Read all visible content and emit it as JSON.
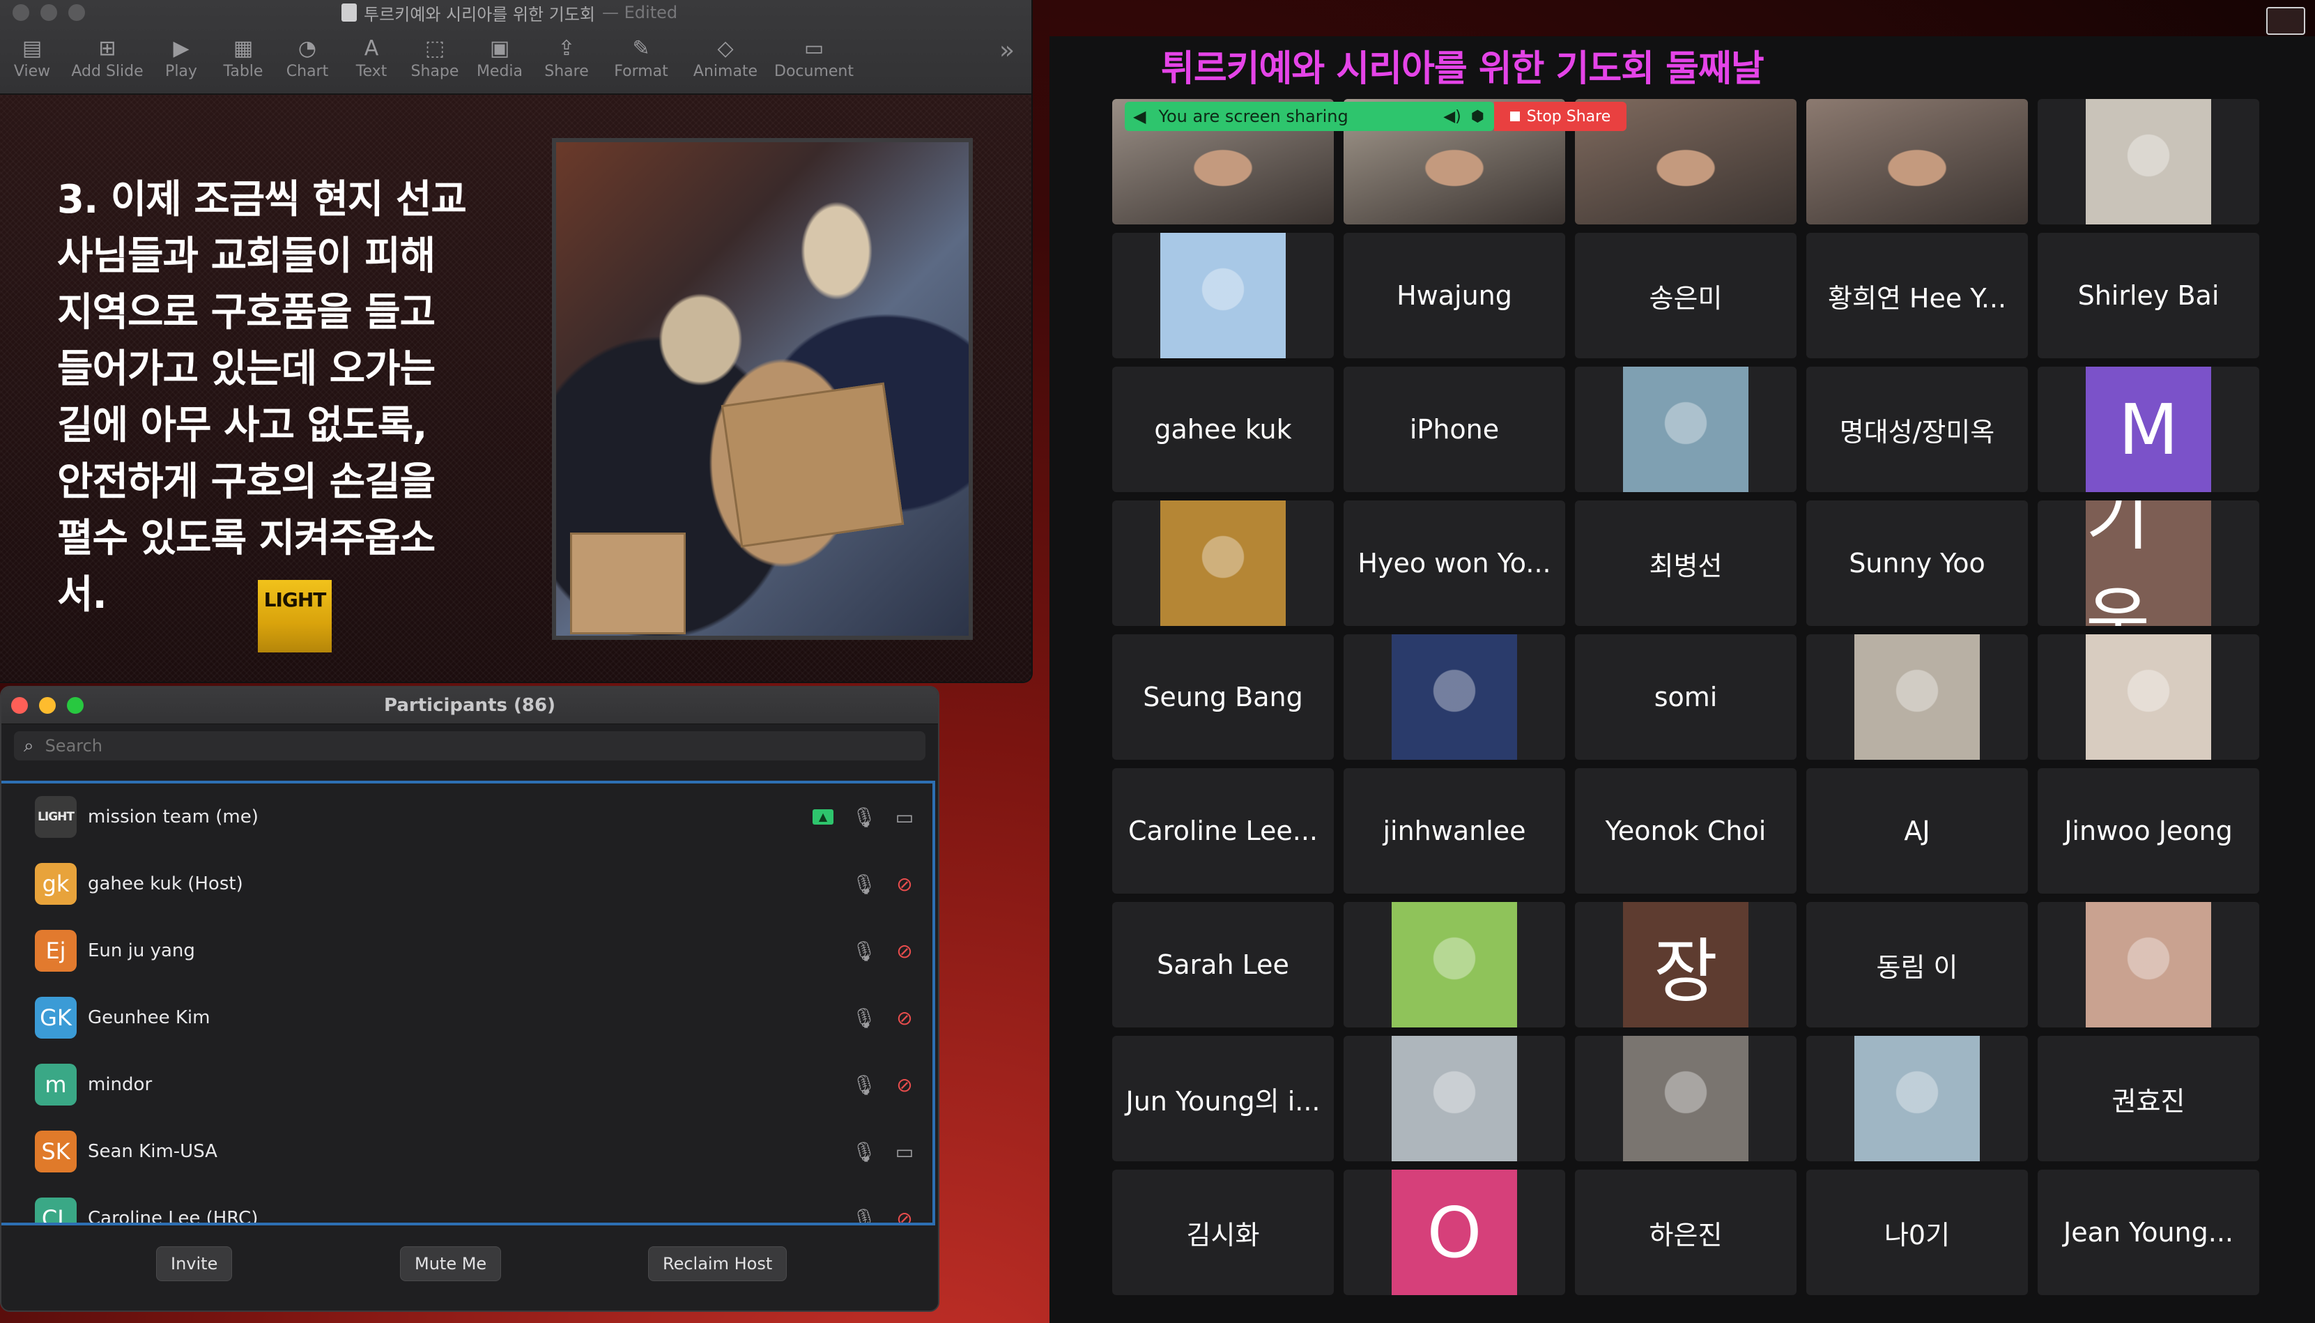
{
  "keynote": {
    "title": "투르키예와 시리아를 위한 기도회",
    "edited": "— Edited",
    "toolbar": [
      "View",
      "Add Slide",
      "Play",
      "Table",
      "Chart",
      "Text",
      "Shape",
      "Media",
      "Share",
      "Format",
      "Animate",
      "Document"
    ],
    "slide_text": "3. 이제 조금씩 현지 선교\n사님들과 교회들이 피해\n지역으로 구호품을 들고\n들어가고 있는데 오가는\n길에 아무 사고 없도록,\n안전하게 구호의 손길을\n펼수 있도록 지켜주옵소\n서.",
    "logo_text": "LIGHT"
  },
  "participants": {
    "title": "Participants (86)",
    "search_placeholder": "Search",
    "rows": [
      {
        "initials": "LIGHT",
        "name": "mission team (me)",
        "color": "#3a3a3a",
        "cam_off": false,
        "sharing": true
      },
      {
        "initials": "gk",
        "name": "gahee kuk (Host)",
        "color": "#e8a33b",
        "cam_off": true,
        "sharing": false
      },
      {
        "initials": "Ej",
        "name": "Eun ju yang",
        "color": "#e27a2e",
        "cam_off": true,
        "sharing": false
      },
      {
        "initials": "GK",
        "name": "Geunhee Kim",
        "color": "#3b9bd6",
        "cam_off": true,
        "sharing": false
      },
      {
        "initials": "m",
        "name": "mindor",
        "color": "#3aa886",
        "cam_off": true,
        "sharing": false
      },
      {
        "initials": "SK",
        "name": "Sean Kim-USA",
        "color": "#e07a2a",
        "cam_off": false,
        "sharing": false
      },
      {
        "initials": "CL",
        "name": "Caroline Lee (HRC)",
        "color": "#3aa886",
        "cam_off": true,
        "sharing": false
      }
    ],
    "buttons": {
      "invite": "Invite",
      "mute": "Mute Me",
      "reclaim": "Reclaim Host"
    }
  },
  "zoom": {
    "title": "튀르키예와 시리아를 위한 기도회 둘째날",
    "share_text": "You are screen sharing",
    "stop_share": "Stop Share",
    "tiles": [
      {
        "type": "video",
        "bg": "#9a8f86"
      },
      {
        "type": "video",
        "bg": "#a49a8e"
      },
      {
        "type": "video",
        "bg": "#7f6a5e"
      },
      {
        "type": "video",
        "bg": "#8c7a70"
      },
      {
        "type": "pic",
        "bg": "#c9c3b9"
      },
      {
        "type": "pic",
        "bg": "#a8c8e6"
      },
      {
        "type": "name",
        "label": "Hwajung"
      },
      {
        "type": "name",
        "label": "송은미"
      },
      {
        "type": "name",
        "label": "황희연  Hee Y..."
      },
      {
        "type": "name",
        "label": "Shirley Bai"
      },
      {
        "type": "name",
        "label": "gahee kuk"
      },
      {
        "type": "name",
        "label": "iPhone"
      },
      {
        "type": "pic",
        "bg": "#7fa0b2"
      },
      {
        "type": "name",
        "label": "명대성/장미옥"
      },
      {
        "type": "letter",
        "label": "M",
        "bg": "#7b52c9"
      },
      {
        "type": "pic",
        "bg": "#b58635"
      },
      {
        "type": "name",
        "label": "Hyeo won Yo..."
      },
      {
        "type": "name",
        "label": "최병선"
      },
      {
        "type": "name",
        "label": "Sunny Yoo"
      },
      {
        "type": "letter",
        "label": "기운",
        "bg": "#7d5e54"
      },
      {
        "type": "name",
        "label": "Seung Bang"
      },
      {
        "type": "pic",
        "bg": "#2a3b6b"
      },
      {
        "type": "name",
        "label": "somi"
      },
      {
        "type": "pic",
        "bg": "#b8b0a4"
      },
      {
        "type": "pic",
        "bg": "#d8ccc0"
      },
      {
        "type": "name",
        "label": "Caroline Lee..."
      },
      {
        "type": "name",
        "label": "jinhwanlee"
      },
      {
        "type": "name",
        "label": "Yeonok Choi"
      },
      {
        "type": "name",
        "label": "AJ"
      },
      {
        "type": "name",
        "label": "Jinwoo Jeong"
      },
      {
        "type": "name",
        "label": "Sarah Lee"
      },
      {
        "type": "pic",
        "bg": "#8fc35a"
      },
      {
        "type": "letter",
        "label": "장",
        "bg": "#5e3c30"
      },
      {
        "type": "name",
        "label": "동림 이"
      },
      {
        "type": "pic",
        "bg": "#c9a290"
      },
      {
        "type": "name",
        "label": "Jun Young의 i..."
      },
      {
        "type": "pic",
        "bg": "#aeb6bc"
      },
      {
        "type": "pic",
        "bg": "#7a7570"
      },
      {
        "type": "pic",
        "bg": "#9fb6c4"
      },
      {
        "type": "name",
        "label": "권효진"
      },
      {
        "type": "name",
        "label": "김시화"
      },
      {
        "type": "letter",
        "label": "O",
        "bg": "#d6407a"
      },
      {
        "type": "name",
        "label": "하은진"
      },
      {
        "type": "name",
        "label": "나0기"
      },
      {
        "type": "name",
        "label": "Jean Young..."
      }
    ]
  }
}
